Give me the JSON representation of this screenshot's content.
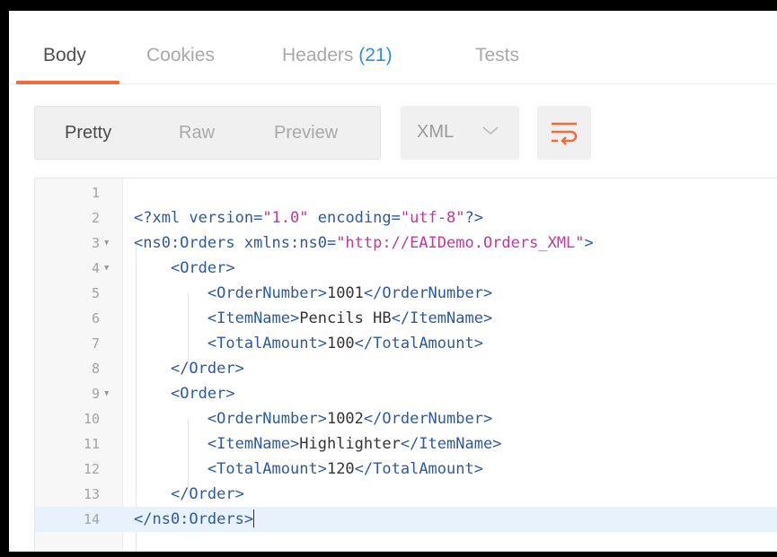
{
  "tabs": [
    {
      "label": "Body",
      "active": true
    },
    {
      "label": "Cookies",
      "active": false
    },
    {
      "label": "Headers",
      "count": "(21)",
      "active": false
    },
    {
      "label": "Tests",
      "active": false
    }
  ],
  "format_buttons": [
    {
      "label": "Pretty",
      "active": true
    },
    {
      "label": "Raw",
      "active": false
    },
    {
      "label": "Preview",
      "active": false
    }
  ],
  "language_select": {
    "value": "XML",
    "icon": "chevron-down-icon"
  },
  "wrap_button": {
    "icon": "wrap-lines-icon",
    "color": "#f26b3a"
  },
  "editor": {
    "current_line": 14,
    "lines": [
      {
        "n": "1",
        "parts": []
      },
      {
        "n": "2",
        "parts": [
          {
            "t": "tag",
            "v": "<?xml "
          },
          {
            "t": "attr",
            "v": "version="
          },
          {
            "t": "str",
            "v": "\"1.0\""
          },
          {
            "t": "attr",
            "v": " encoding="
          },
          {
            "t": "str",
            "v": "\"utf-8\""
          },
          {
            "t": "tag",
            "v": "?>"
          }
        ]
      },
      {
        "n": "3",
        "fold": true,
        "parts": [
          {
            "t": "tag",
            "v": "<ns0:Orders "
          },
          {
            "t": "attr",
            "v": "xmlns:ns0="
          },
          {
            "t": "str",
            "v": "\"http://EAIDemo.Orders_XML\""
          },
          {
            "t": "tag",
            "v": ">"
          }
        ]
      },
      {
        "n": "4",
        "fold": true,
        "parts": [
          {
            "t": "txt",
            "v": "    "
          },
          {
            "t": "tag",
            "v": "<Order>"
          }
        ]
      },
      {
        "n": "5",
        "parts": [
          {
            "t": "txt",
            "v": "        "
          },
          {
            "t": "tag",
            "v": "<OrderNumber>"
          },
          {
            "t": "txt",
            "v": "1001"
          },
          {
            "t": "tag",
            "v": "</OrderNumber>"
          }
        ]
      },
      {
        "n": "6",
        "parts": [
          {
            "t": "txt",
            "v": "        "
          },
          {
            "t": "tag",
            "v": "<ItemName>"
          },
          {
            "t": "txt",
            "v": "Pencils HB"
          },
          {
            "t": "tag",
            "v": "</ItemName>"
          }
        ]
      },
      {
        "n": "7",
        "parts": [
          {
            "t": "txt",
            "v": "        "
          },
          {
            "t": "tag",
            "v": "<TotalAmount>"
          },
          {
            "t": "txt",
            "v": "100"
          },
          {
            "t": "tag",
            "v": "</TotalAmount>"
          }
        ]
      },
      {
        "n": "8",
        "parts": [
          {
            "t": "txt",
            "v": "    "
          },
          {
            "t": "tag",
            "v": "</Order>"
          }
        ]
      },
      {
        "n": "9",
        "fold": true,
        "parts": [
          {
            "t": "txt",
            "v": "    "
          },
          {
            "t": "tag",
            "v": "<Order>"
          }
        ]
      },
      {
        "n": "10",
        "parts": [
          {
            "t": "txt",
            "v": "        "
          },
          {
            "t": "tag",
            "v": "<OrderNumber>"
          },
          {
            "t": "txt",
            "v": "1002"
          },
          {
            "t": "tag",
            "v": "</OrderNumber>"
          }
        ]
      },
      {
        "n": "11",
        "parts": [
          {
            "t": "txt",
            "v": "        "
          },
          {
            "t": "tag",
            "v": "<ItemName>"
          },
          {
            "t": "txt",
            "v": "Highlighter"
          },
          {
            "t": "tag",
            "v": "</ItemName>"
          }
        ]
      },
      {
        "n": "12",
        "parts": [
          {
            "t": "txt",
            "v": "        "
          },
          {
            "t": "tag",
            "v": "<TotalAmount>"
          },
          {
            "t": "txt",
            "v": "120"
          },
          {
            "t": "tag",
            "v": "</TotalAmount>"
          }
        ]
      },
      {
        "n": "13",
        "parts": [
          {
            "t": "txt",
            "v": "    "
          },
          {
            "t": "tag",
            "v": "</Order>"
          }
        ]
      },
      {
        "n": "14",
        "parts": [
          {
            "t": "tag",
            "v": "</ns0:Orders>"
          }
        ]
      }
    ]
  }
}
